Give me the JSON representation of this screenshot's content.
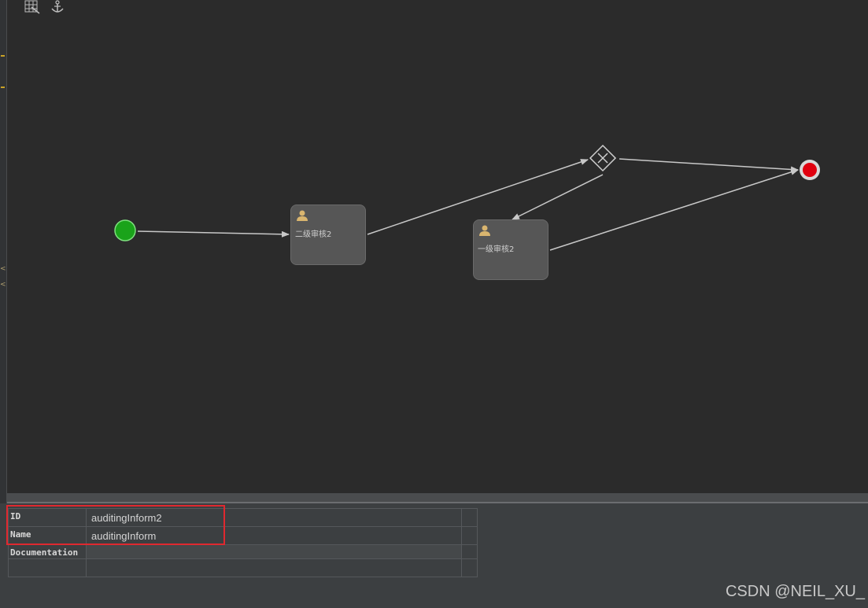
{
  "toolbar": {
    "icons": [
      "grid-icon",
      "anchor-icon"
    ]
  },
  "diagram": {
    "start_event": {
      "color": "#1aa31a"
    },
    "end_event": {
      "color": "#e0000f"
    },
    "gateway": {
      "type": "exclusive"
    },
    "tasks": [
      {
        "label": "二级审核2"
      },
      {
        "label": "一级审核2"
      }
    ],
    "user_icon_color": "#d9b56f"
  },
  "properties": {
    "rows": [
      {
        "key": "ID",
        "value": "auditingInform2"
      },
      {
        "key": "Name",
        "value": "auditingInform"
      },
      {
        "key": "Documentation",
        "value": ""
      },
      {
        "key": "",
        "value": ""
      }
    ]
  },
  "watermark": "CSDN @NEIL_XU_"
}
